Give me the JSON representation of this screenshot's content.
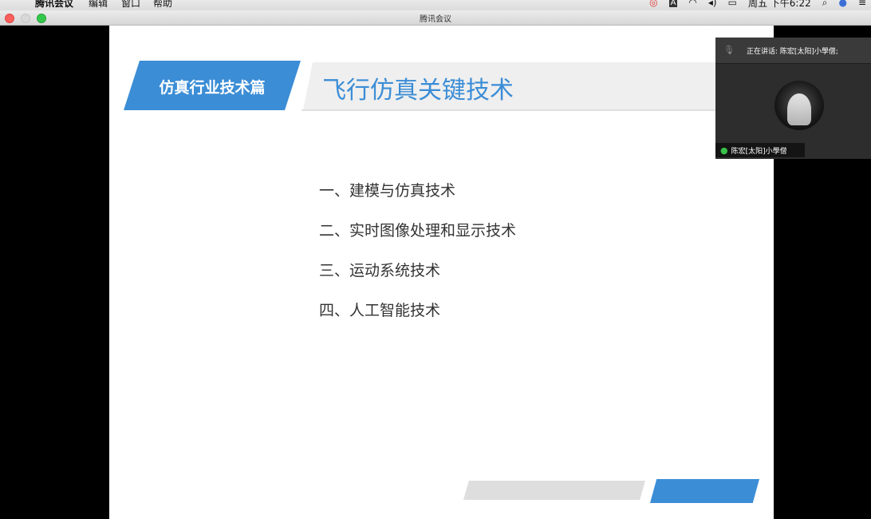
{
  "menubar": {
    "app_name": "腾讯会议",
    "menu_edit": "编辑",
    "menu_window": "窗口",
    "menu_help": "帮助",
    "datetime": "周五 下午6:22"
  },
  "window": {
    "title": "腾讯会议"
  },
  "slide": {
    "tag": "仿真行业技术篇",
    "title": "飞行仿真关键技术",
    "items": [
      "一、建模与仿真技术",
      "二、实时图像处理和显示技术",
      "三、运动系统技术",
      "四、人工智能技术"
    ]
  },
  "video_panel": {
    "speaking_label": "正在讲话: 陈宏[太阳]小學僧;",
    "participant_name": "陈宏[太阳]小學僧"
  },
  "colors": {
    "accent": "#3b8dd6"
  }
}
